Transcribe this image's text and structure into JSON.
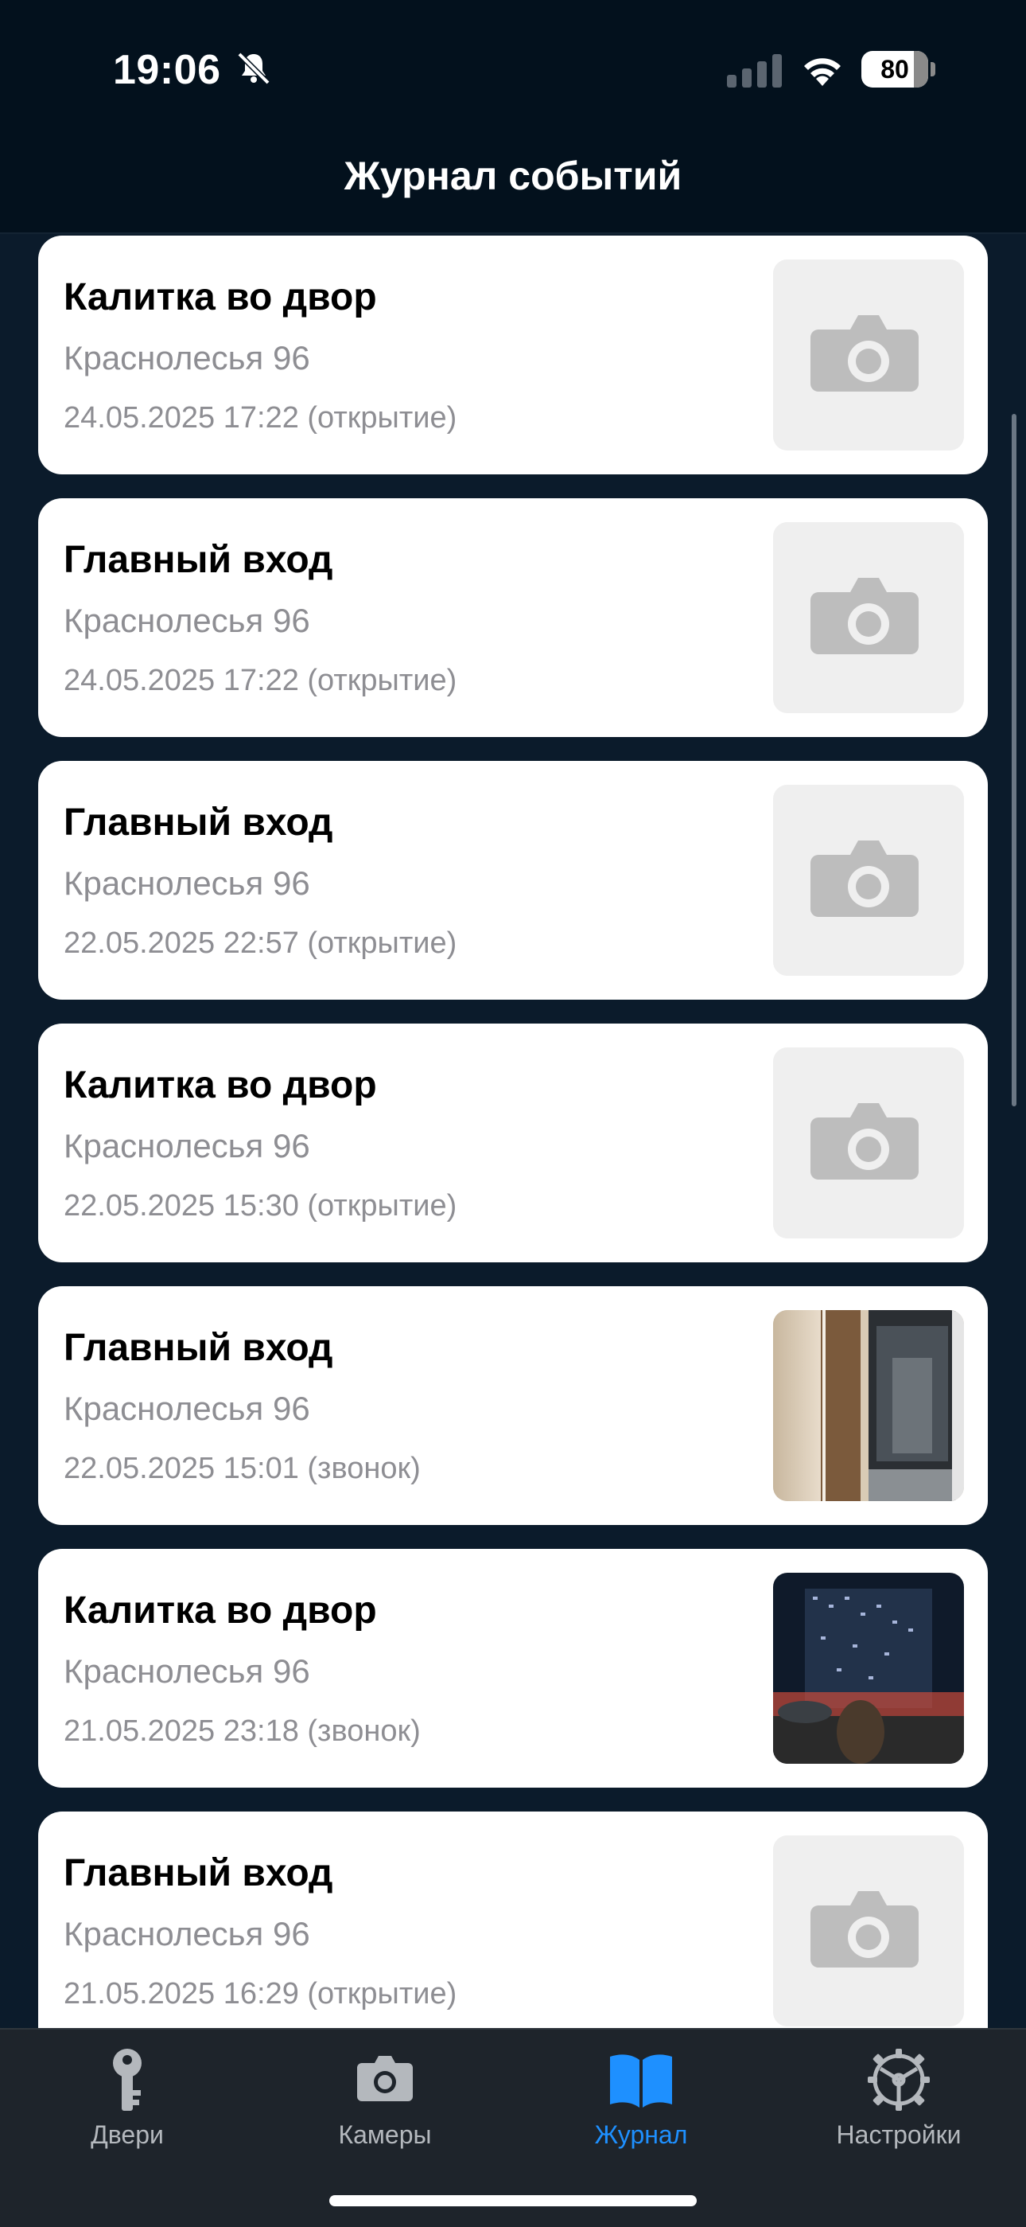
{
  "status": {
    "time": "19:06",
    "battery": "80"
  },
  "header": {
    "title": "Журнал событий"
  },
  "events": [
    {
      "title": "Калитка во двор",
      "address": "Краснолесья 96",
      "datetime": "24.05.2025 17:22 (открытие)",
      "thumb": "camera-placeholder"
    },
    {
      "title": "Главный вход",
      "address": "Краснолесья 96",
      "datetime": "24.05.2025 17:22 (открытие)",
      "thumb": "camera-placeholder"
    },
    {
      "title": "Главный вход",
      "address": "Краснолесья 96",
      "datetime": "22.05.2025 22:57 (открытие)",
      "thumb": "camera-placeholder"
    },
    {
      "title": "Калитка во двор",
      "address": "Краснолесья 96",
      "datetime": "22.05.2025 15:30 (открытие)",
      "thumb": "camera-placeholder"
    },
    {
      "title": "Главный вход",
      "address": "Краснолесья 96",
      "datetime": "22.05.2025 15:01 (звонок)",
      "thumb": "photo-entrance"
    },
    {
      "title": "Калитка во двор",
      "address": "Краснолесья 96",
      "datetime": "21.05.2025 23:18 (звонок)",
      "thumb": "photo-yard"
    },
    {
      "title": "Главный вход",
      "address": "Краснолесья 96",
      "datetime": "21.05.2025 16:29 (открытие)",
      "thumb": "camera-placeholder"
    }
  ],
  "tabs": [
    {
      "label": "Двери",
      "icon": "key-icon",
      "active": false
    },
    {
      "label": "Камеры",
      "icon": "camera-icon",
      "active": false
    },
    {
      "label": "Журнал",
      "icon": "book-icon",
      "active": true
    },
    {
      "label": "Настройки",
      "icon": "gear-icon",
      "active": false
    }
  ],
  "colors": {
    "accent": "#1e90ff",
    "background": "#0b1b2b",
    "card": "#ffffff",
    "secondary_text": "#8e8e93"
  }
}
